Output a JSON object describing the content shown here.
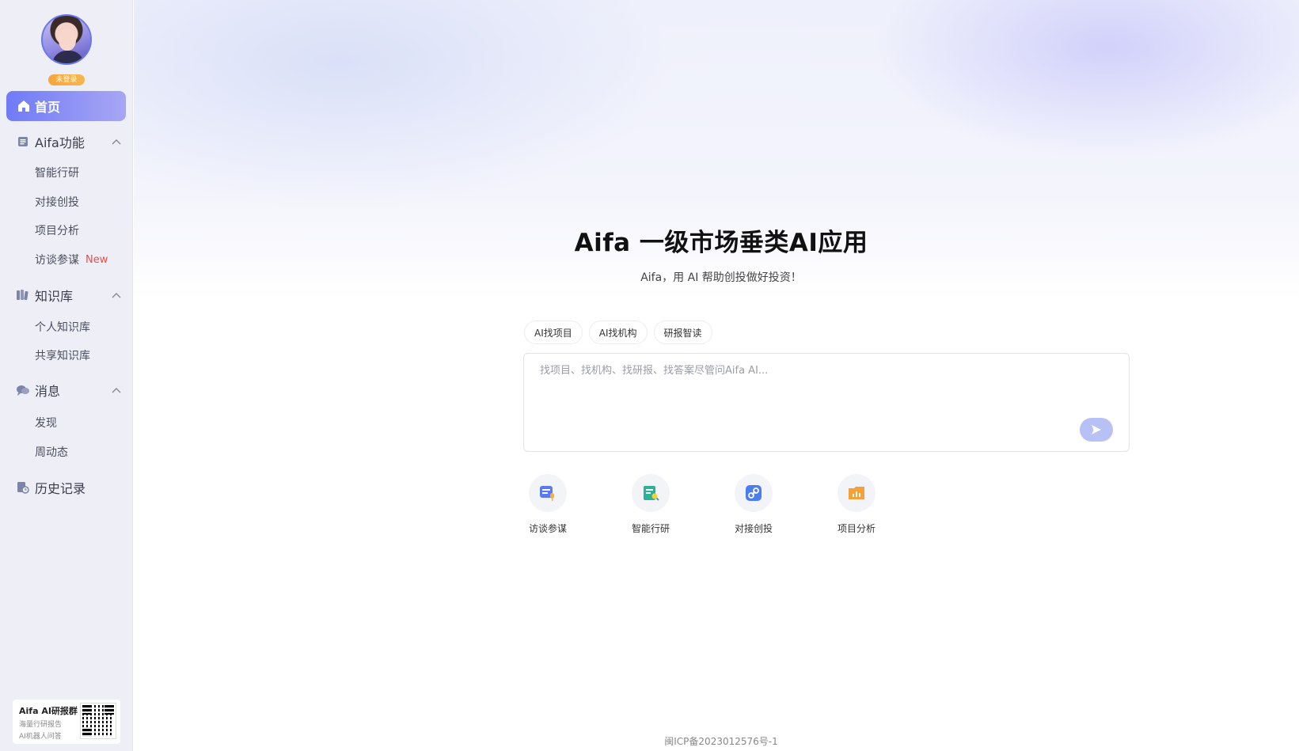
{
  "sidebar": {
    "login_badge": "未登录",
    "home_label": "首页",
    "groups": [
      {
        "label": "Aifa功能",
        "icon": "document-icon",
        "items": [
          {
            "label": "智能行研"
          },
          {
            "label": "对接创投"
          },
          {
            "label": "项目分析"
          },
          {
            "label": "访谈参谋",
            "tag": "New"
          }
        ]
      },
      {
        "label": "知识库",
        "icon": "book-icon",
        "items": [
          {
            "label": "个人知识库"
          },
          {
            "label": "共享知识库"
          }
        ]
      },
      {
        "label": "消息",
        "icon": "chat-icon",
        "items": [
          {
            "label": "发现"
          },
          {
            "label": "周动态"
          }
        ]
      }
    ],
    "history_label": "历史记录",
    "qr_card": {
      "title": "Aifa AI研报群",
      "line1": "海量行研报告",
      "line2": "AI机器人问答"
    }
  },
  "main": {
    "title": "Aifa 一级市场垂类AI应用",
    "subtitle": "Aifa，用 AI 帮助创投做好投资！",
    "chips": [
      "AI找项目",
      "AI找机构",
      "研报智读"
    ],
    "input_placeholder": "找项目、找机构、找研报、找答案尽管问Aifa AI...",
    "quick_actions": [
      {
        "label": "访谈参谋",
        "icon": "interview-icon",
        "color": "#5b79f0"
      },
      {
        "label": "智能行研",
        "icon": "research-icon",
        "color": "#2bb39a"
      },
      {
        "label": "对接创投",
        "icon": "link-icon",
        "color": "#4c7df0"
      },
      {
        "label": "项目分析",
        "icon": "analysis-icon",
        "color": "#f5a13a"
      }
    ],
    "footer": "闽ICP备2023012576号-1"
  },
  "colors": {
    "accent": "#6f7bf6",
    "new_tag": "#f04a4a",
    "badge": "#f7a53c"
  }
}
